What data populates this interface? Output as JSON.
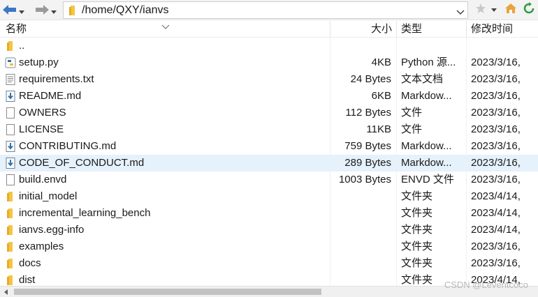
{
  "toolbar": {
    "path": "/home/QXY/ianvs"
  },
  "columns": {
    "name": "名称",
    "size": "大小",
    "type": "类型",
    "modified": "修改时间"
  },
  "files": [
    {
      "name": "..",
      "size": "",
      "type": "",
      "modified": "",
      "icon": "folder-icon"
    },
    {
      "name": "setup.py",
      "size": "4KB",
      "type": "Python 源...",
      "modified": "2023/3/16,",
      "icon": "python-file-icon"
    },
    {
      "name": "requirements.txt",
      "size": "24 Bytes",
      "type": "文本文档",
      "modified": "2023/3/16,",
      "icon": "text-file-icon"
    },
    {
      "name": "README.md",
      "size": "6KB",
      "type": "Markdow...",
      "modified": "2023/3/16,",
      "icon": "markdown-file-icon"
    },
    {
      "name": "OWNERS",
      "size": "112 Bytes",
      "type": "文件",
      "modified": "2023/3/16,",
      "icon": "file-icon"
    },
    {
      "name": "LICENSE",
      "size": "11KB",
      "type": "文件",
      "modified": "2023/3/16,",
      "icon": "file-icon"
    },
    {
      "name": "CONTRIBUTING.md",
      "size": "759 Bytes",
      "type": "Markdow...",
      "modified": "2023/3/16,",
      "icon": "markdown-file-icon"
    },
    {
      "name": "CODE_OF_CONDUCT.md",
      "size": "289 Bytes",
      "type": "Markdow...",
      "modified": "2023/3/16,",
      "icon": "markdown-file-icon",
      "selected": true
    },
    {
      "name": "build.envd",
      "size": "1003 Bytes",
      "type": "ENVD 文件",
      "modified": "2023/3/16,",
      "icon": "file-icon"
    },
    {
      "name": "initial_model",
      "size": "",
      "type": "文件夹",
      "modified": "2023/4/14,",
      "icon": "folder-icon"
    },
    {
      "name": "incremental_learning_bench",
      "size": "",
      "type": "文件夹",
      "modified": "2023/4/14,",
      "icon": "folder-icon"
    },
    {
      "name": "ianvs.egg-info",
      "size": "",
      "type": "文件夹",
      "modified": "2023/4/14,",
      "icon": "folder-icon"
    },
    {
      "name": "examples",
      "size": "",
      "type": "文件夹",
      "modified": "2023/3/16,",
      "icon": "folder-icon"
    },
    {
      "name": "docs",
      "size": "",
      "type": "文件夹",
      "modified": "2023/3/16,",
      "icon": "folder-icon"
    },
    {
      "name": "dist",
      "size": "",
      "type": "文件夹",
      "modified": "2023/4/14,",
      "icon": "folder-icon"
    }
  ],
  "watermark": "CSDN @Leventcoco",
  "colors": {
    "selection": "#e5f1fb",
    "folder": "#f5c542",
    "nav_arrow": "#3b78c4"
  }
}
